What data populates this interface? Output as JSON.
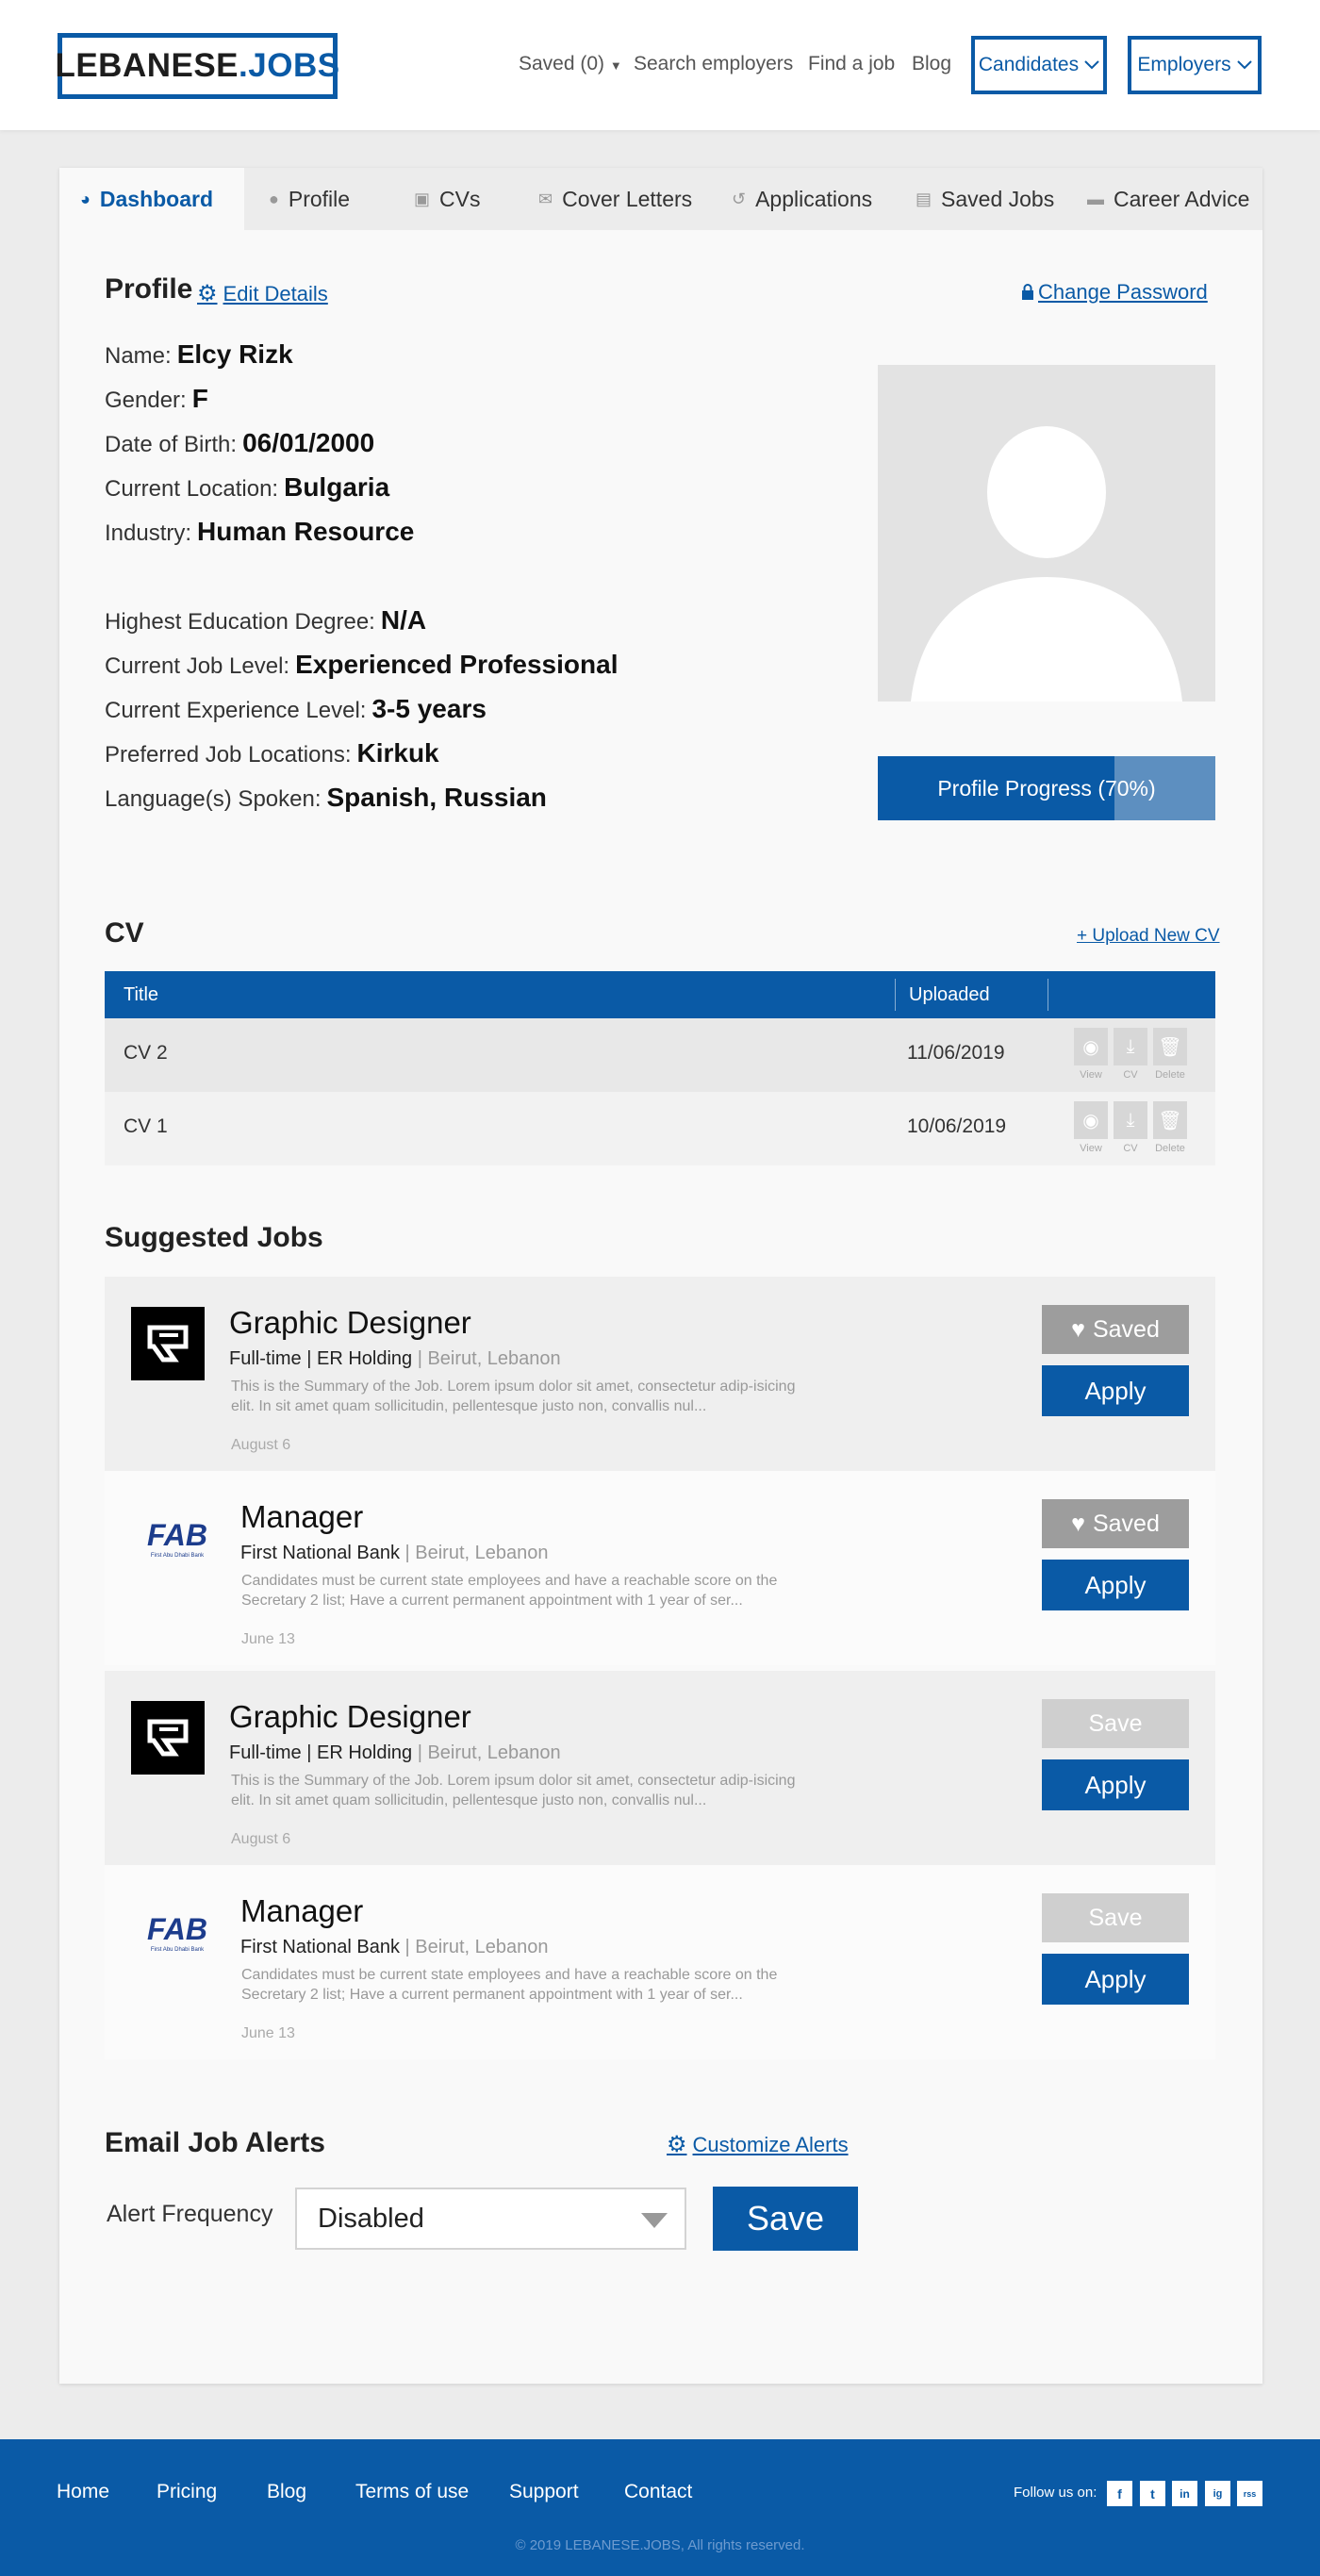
{
  "header": {
    "logo_main": "LEBANESE",
    "logo_dot": ".JOBS",
    "nav": {
      "saved": "Saved (0)",
      "search_employers": "Search employers",
      "find_job": "Find a job",
      "blog": "Blog",
      "candidates": "Candidates",
      "employers": "Employers"
    }
  },
  "tabs": [
    "Dashboard",
    "Profile",
    "CVs",
    "Cover Letters",
    "Applications",
    "Saved Jobs",
    "Career Advice"
  ],
  "profile": {
    "title": "Profile",
    "edit_details": "Edit Details",
    "change_password": "Change Password",
    "fields": [
      {
        "label": "Name:",
        "value": "Elcy Rizk"
      },
      {
        "label": "Gender:",
        "value": "F"
      },
      {
        "label": "Date of Birth:",
        "value": "06/01/2000"
      },
      {
        "label": "Current Location:",
        "value": "Bulgaria"
      },
      {
        "label": "Industry:",
        "value": "Human Resource"
      },
      {
        "label": "Highest Education Degree:",
        "value": "N/A"
      },
      {
        "label": "Current Job Level:",
        "value": "Experienced Professional"
      },
      {
        "label": "Current Experience Level:",
        "value": "3-5 years"
      },
      {
        "label": "Preferred Job Locations:",
        "value": "Kirkuk"
      },
      {
        "label": "Language(s) Spoken:",
        "value": "Spanish, Russian"
      }
    ],
    "progress_label": "Profile Progress (70%)",
    "progress": 0.7
  },
  "cv": {
    "title": "CV",
    "upload": "+ Upload New CV",
    "headers": {
      "title": "Title",
      "uploaded": "Uploaded"
    },
    "rows": [
      {
        "title": "CV 2",
        "uploaded": "11/06/2019"
      },
      {
        "title": "CV 1",
        "uploaded": "10/06/2019"
      }
    ],
    "actions": {
      "view": "View",
      "cv": "CV",
      "delete": "Delete"
    }
  },
  "suggested": {
    "title": "Suggested Jobs",
    "jobs": [
      {
        "title": "Graphic Designer",
        "company": "Full-time | ER Holding",
        "location": " | Beirut, Lebanon",
        "desc": "This is the Summary of the Job. Lorem ipsum dolor sit amet, consectetur adip-isicing elit. In sit amet quam sollicitudin, pellentesque justo non, convallis nul...",
        "date": "August 6",
        "save_label": "Saved",
        "saved": true,
        "apply": "Apply",
        "logo": "er-logo"
      },
      {
        "title": "Manager",
        "company": "First National Bank",
        "location": " | Beirut, Lebanon",
        "desc": "Candidates must be current state employees and have a reachable score on the Secretary 2 list; Have a current permanent appointment with 1 year of ser...",
        "date": "June 13",
        "save_label": "Saved",
        "saved": true,
        "apply": "Apply",
        "logo": "fab-logo"
      },
      {
        "title": "Graphic Designer",
        "company": "Full-time | ER Holding",
        "location": " | Beirut, Lebanon",
        "desc": "This is the Summary of the Job. Lorem ipsum dolor sit amet, consectetur adip-isicing elit. In sit amet quam sollicitudin, pellentesque justo non, convallis nul...",
        "date": "August 6",
        "save_label": "Save",
        "saved": false,
        "apply": "Apply",
        "logo": "er-logo"
      },
      {
        "title": "Manager",
        "company": "First National Bank",
        "location": " | Beirut, Lebanon",
        "desc": "Candidates must be current state employees and have a reachable score on the Secretary 2 list; Have a current permanent appointment with 1 year of ser...",
        "date": "June 13",
        "save_label": "Save",
        "saved": false,
        "apply": "Apply",
        "logo": "fab-logo"
      }
    ],
    "fab_text": "FAB",
    "fab_sub": "First Abu Dhabi Bank"
  },
  "alerts": {
    "title": "Email Job Alerts",
    "customize": "Customize Alerts",
    "frequency_label": "Alert Frequency",
    "frequency_value": "Disabled",
    "save": "Save"
  },
  "footer": {
    "links": [
      "Home",
      "Pricing",
      "Blog",
      "Terms of use",
      "Support",
      "Contact"
    ],
    "follow": "Follow us on:",
    "social": [
      "f",
      "t",
      "in",
      "ig",
      "rss"
    ],
    "copyright": "© 2019 LEBANESE.JOBS, All rights reserved."
  },
  "colors": {
    "brand": "#0a5aa6",
    "saved": "#9d9d9d",
    "save_disabled": "#cfcfcf"
  }
}
